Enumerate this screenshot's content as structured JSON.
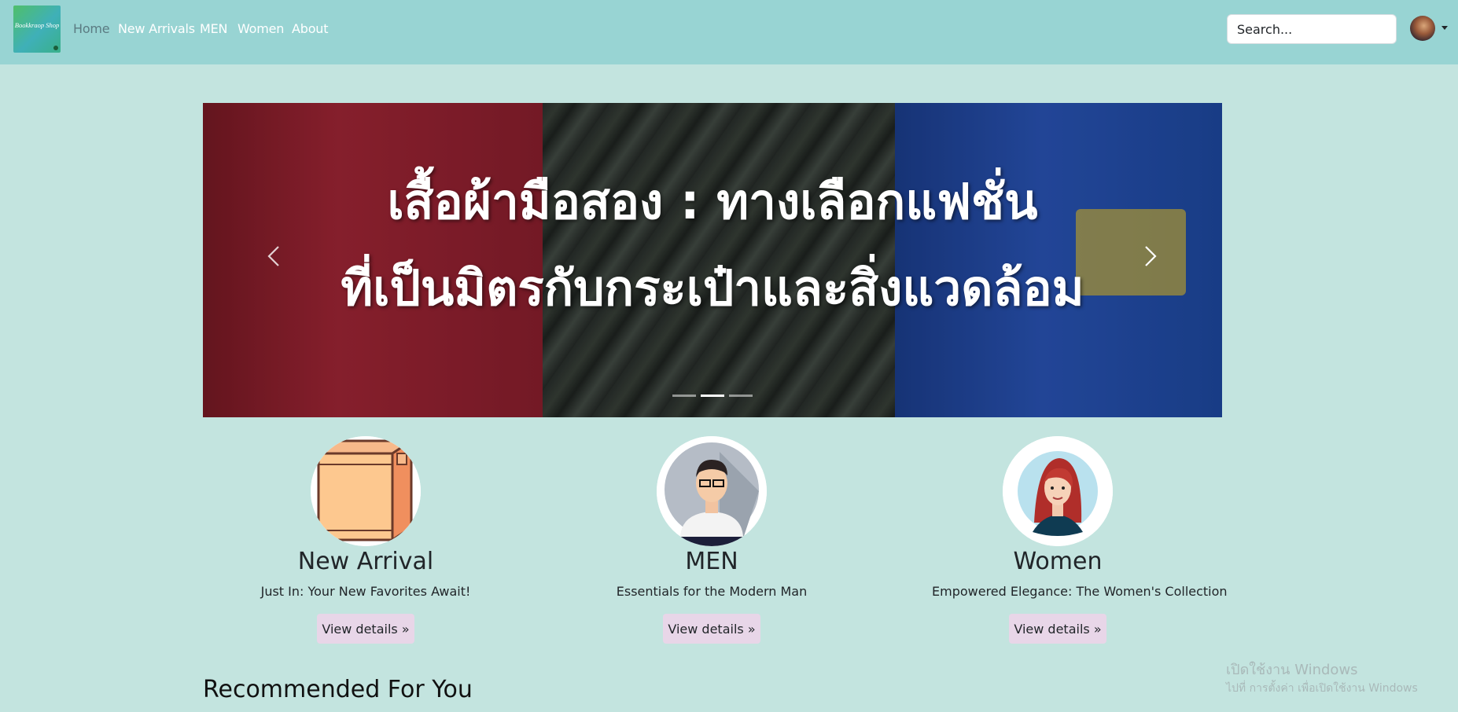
{
  "navbar": {
    "brand_text": "Bookkraop Shop",
    "links": [
      {
        "label": "Home",
        "active": true
      },
      {
        "label": "New Arrivals",
        "active": false
      },
      {
        "label": "MEN",
        "active": false
      },
      {
        "label": "Women",
        "active": false
      },
      {
        "label": "About",
        "active": false
      }
    ],
    "search_placeholder": "Search...",
    "avatar_icon": "user-avatar-icon",
    "caret_icon": "chevron-down-icon"
  },
  "carousel": {
    "headline_line1": "เสื้อผ้ามือสอง : ทางเลือกแฟชั่น",
    "headline_line2": "ที่เป็นมิตรกับกระเป๋าและสิ่งแวดล้อม",
    "prev_icon": "chevron-left-icon",
    "next_icon": "chevron-right-icon",
    "slide_count": 3,
    "active_slide": 2
  },
  "categories": [
    {
      "title": "New Arrival",
      "subtitle": "Just In: Your New Favorites Await!",
      "button": "View details »",
      "icon": "box-icon"
    },
    {
      "title": "MEN",
      "subtitle": "Essentials for the Modern Man",
      "button": "View details »",
      "icon": "man-avatar-icon"
    },
    {
      "title": "Women",
      "subtitle": "Empowered Elegance: The Women's Collection",
      "button": "View details »",
      "icon": "woman-avatar-icon"
    }
  ],
  "recommended_title": "Recommended For You",
  "watermark": {
    "line1": "เปิดใช้งาน Windows",
    "line2": "ไปที่ การตั้งค่า เพื่อเปิดใช้งาน Windows"
  },
  "colors": {
    "navbar_bg": "#98d4d3",
    "page_bg": "#c3e4df",
    "button_bg": "#e8d6e8"
  }
}
